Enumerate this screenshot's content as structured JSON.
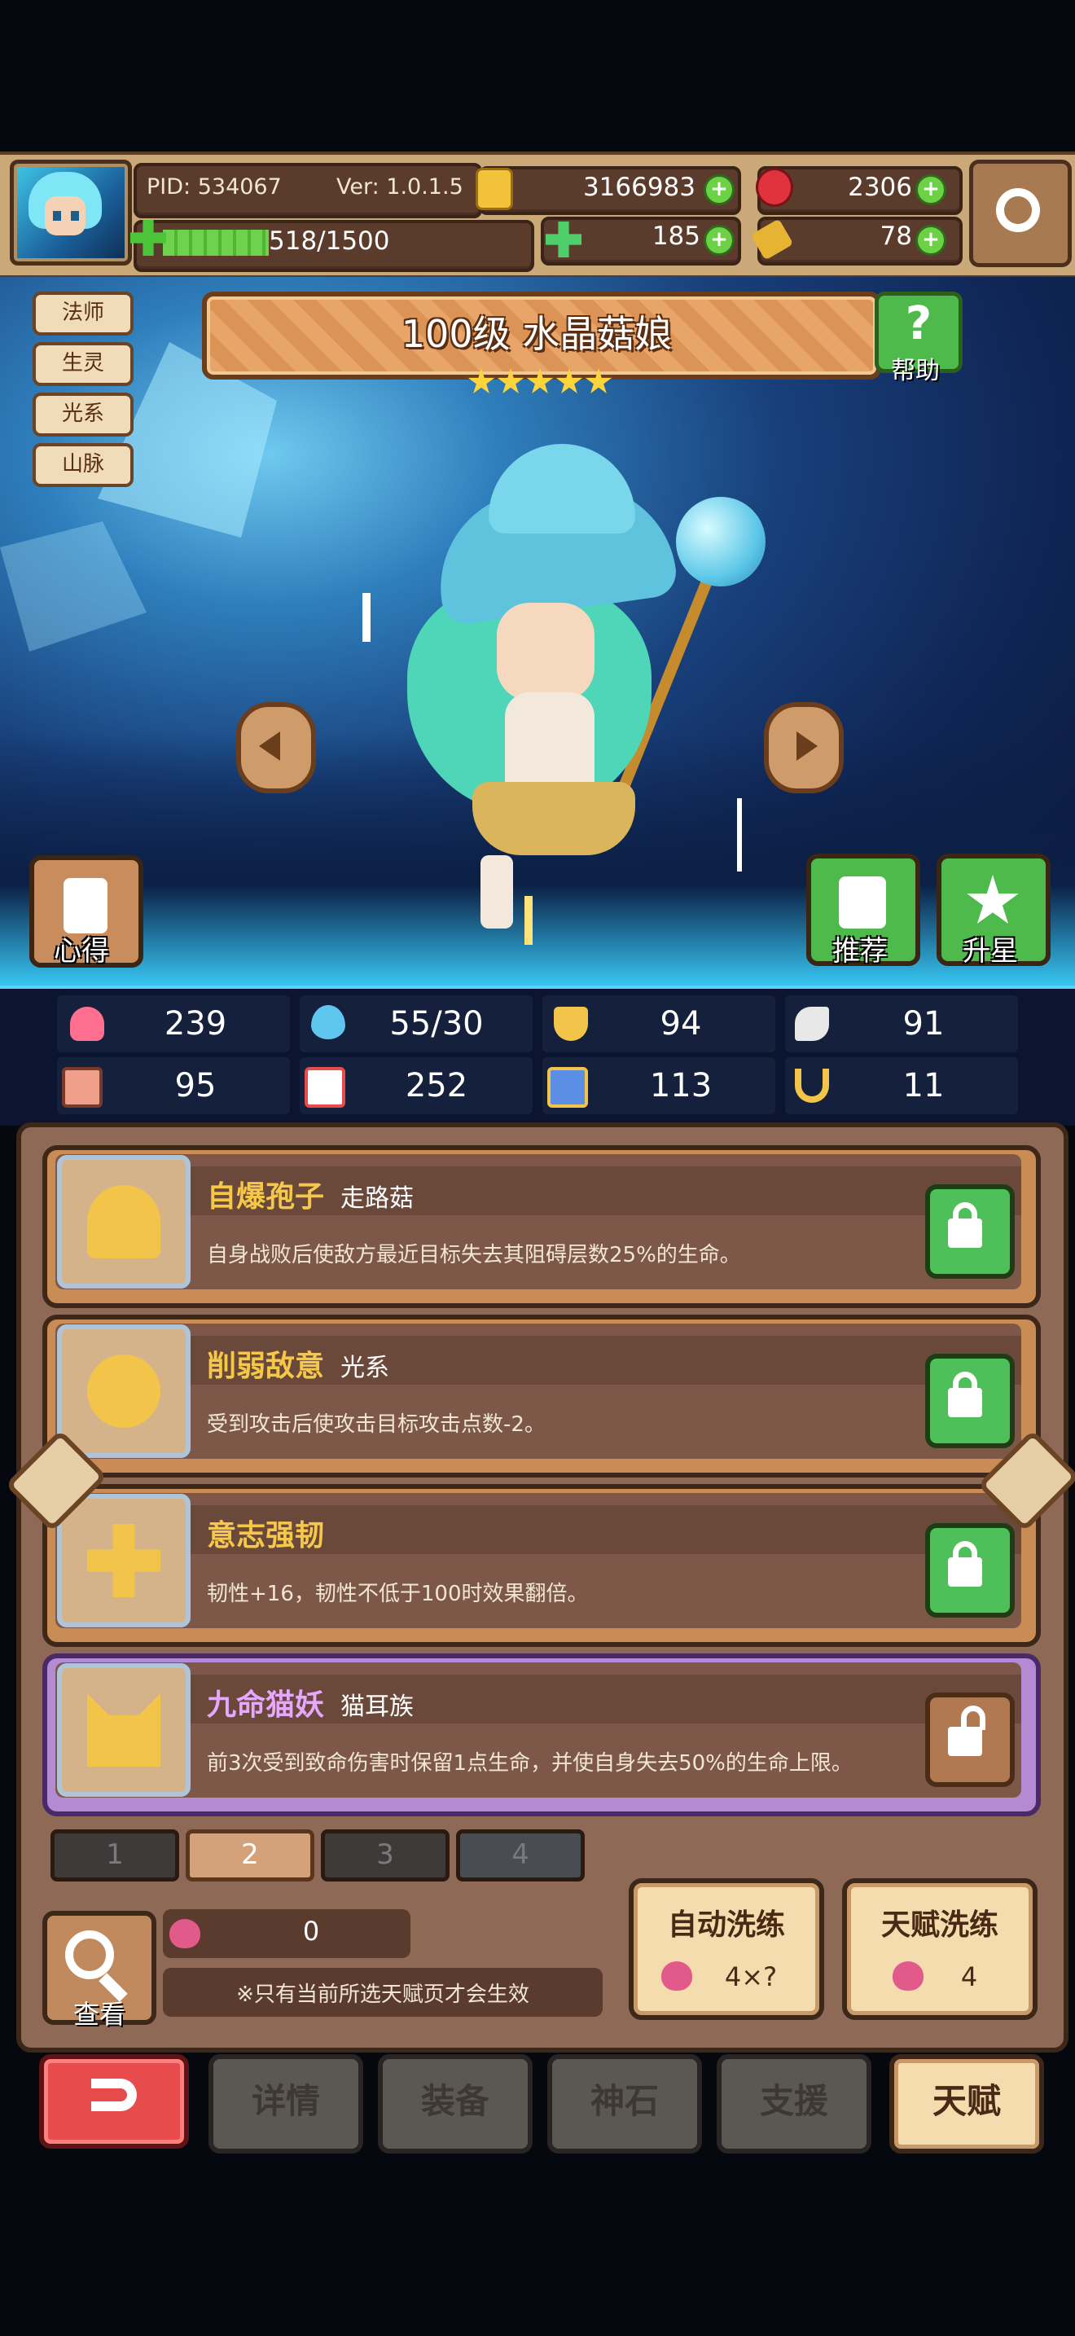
{
  "player": {
    "pid": "PID: 534067",
    "version": "Ver: 1.0.1.5"
  },
  "xp": {
    "text": "518/1500",
    "fraction": 0.345
  },
  "resources": {
    "gold": "3166983",
    "ruby": "2306",
    "clover": "185",
    "key": "78"
  },
  "hero": {
    "name": "100级 水晶菇娘",
    "stars": 5,
    "tags": [
      "法师",
      "生灵",
      "光系",
      "山脉"
    ]
  },
  "buttons": {
    "help": "帮助",
    "insight": "心得",
    "recommend": "推荐",
    "star_up": "升星"
  },
  "stats": [
    {
      "icon": "heart-icon",
      "value": "239",
      "color": "#ff6f8f"
    },
    {
      "icon": "drop-icon",
      "value": "55/30",
      "color": "#5fc6f0"
    },
    {
      "icon": "shield-icon",
      "value": "94",
      "color": "#f2c54a"
    },
    {
      "icon": "wing-icon",
      "value": "91",
      "color": "#e8e8e8"
    },
    {
      "icon": "fist-icon",
      "value": "95",
      "color": "#f0a08a"
    },
    {
      "icon": "book-icon",
      "value": "252",
      "color": "#e84b4b"
    },
    {
      "icon": "boot-icon",
      "value": "113",
      "color": "#5b8fe6"
    },
    {
      "icon": "horseshoe-icon",
      "value": "11",
      "color": "#f2c54a"
    }
  ],
  "talents": [
    {
      "name": "自爆孢子",
      "sub": "走路菇",
      "desc": "自身战败后使敌方最近目标失去其阻碍层数25%的生命。",
      "locked": true,
      "color": "gold"
    },
    {
      "name": "削弱敌意",
      "sub": "光系",
      "desc": "受到攻击后使攻击目标攻击点数-2。",
      "locked": true,
      "color": "gold"
    },
    {
      "name": "意志强韧",
      "sub": "",
      "desc": "韧性+16，韧性不低于100时效果翻倍。",
      "locked": true,
      "color": "gold"
    },
    {
      "name": "九命猫妖",
      "sub": "猫耳族",
      "desc": "前3次受到致命伤害时保留1点生命，并使自身失去50%的生命上限。",
      "locked": false,
      "color": "purple"
    }
  ],
  "pages": [
    "1",
    "2",
    "3",
    "4"
  ],
  "active_page": 1,
  "bottom": {
    "view_label": "查看",
    "peach_count": "0",
    "note": "※只有当前所选天赋页才会生效",
    "auto_wash_title": "自动洗练",
    "auto_wash_cost": "4×?",
    "talent_wash_title": "天赋洗练",
    "talent_wash_cost": "4"
  },
  "nav": [
    "详情",
    "装备",
    "神石",
    "支援",
    "天赋"
  ],
  "active_nav": 4
}
